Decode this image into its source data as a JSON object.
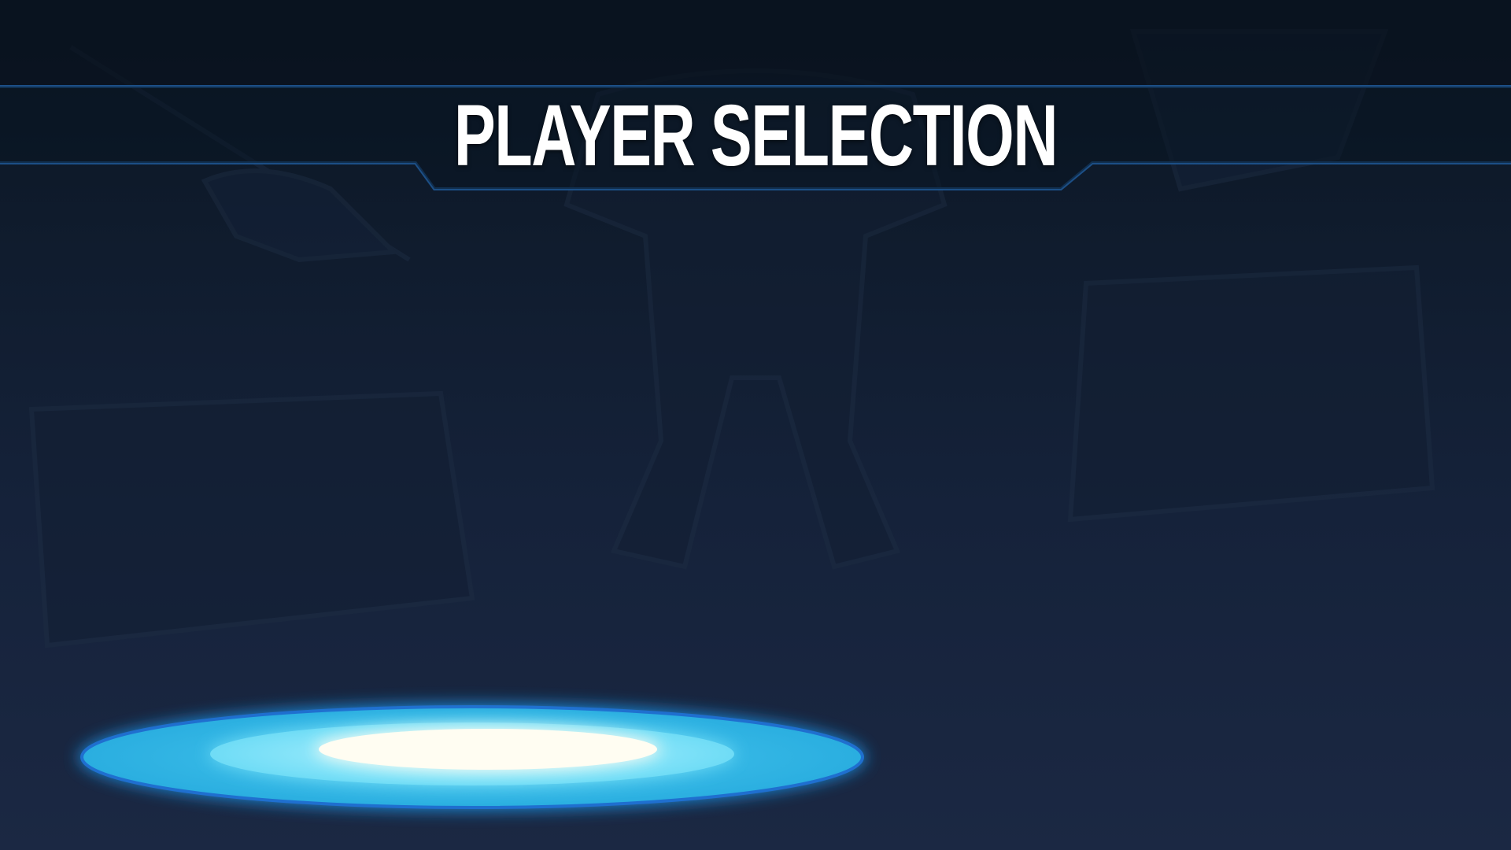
{
  "screen": {
    "title": "PLAYER SELECTION"
  },
  "colors": {
    "background_top": "#0a1420",
    "background_bottom": "#1b2843",
    "frame_line": "#1c4f86",
    "platform_outer": "#2bb8e6",
    "platform_mid": "#7fe6ff",
    "platform_core": "#fffdf2",
    "title_text": "#ffffff"
  },
  "icons": {
    "background": "mech-silhouette-artwork",
    "platform": "glowing-spawn-platform"
  }
}
